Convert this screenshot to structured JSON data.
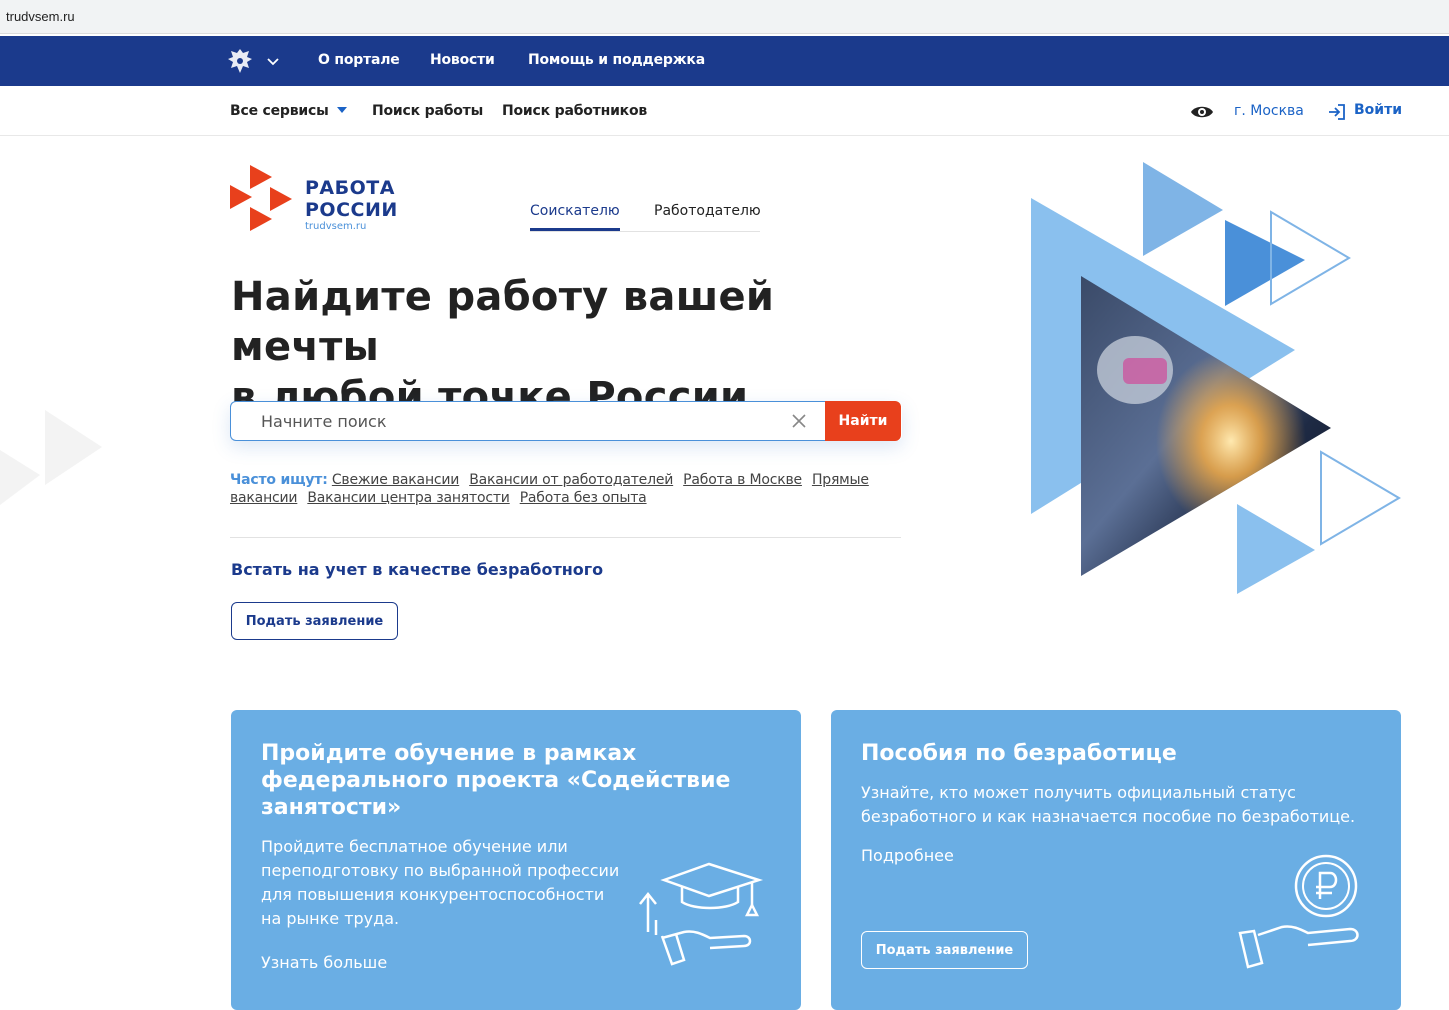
{
  "browser": {
    "url": "trudvsem.ru"
  },
  "gov_bar": {
    "emblem": "russian-coat-of-arms-icon",
    "links": [
      "О портале",
      "Новости",
      "Помощь и поддержка"
    ]
  },
  "nav": {
    "services": "Все сервисы",
    "job_search": "Поиск работы",
    "worker_search": "Поиск работников",
    "accessibility_icon": "eye-icon",
    "city": "г. Москва",
    "login": "Войти"
  },
  "logo": {
    "line1": "РАБОТА",
    "line2": "РОССИИ",
    "sub": "trudvsem.ru"
  },
  "tabs": [
    "Соискателю",
    "Работодателю"
  ],
  "hero": {
    "title_line1": "Найдите работу вашей мечты",
    "title_line2": "в любой точке России"
  },
  "search": {
    "placeholder": "Начните поиск",
    "button": "Найти"
  },
  "often": {
    "label": "Часто ищут:",
    "links": [
      "Свежие вакансии",
      "Вакансии от работодателей",
      "Работа в Москве",
      "Прямые вакансии",
      "Вакансии центра занятости",
      "Работа без опыта"
    ]
  },
  "unemployment": {
    "title": "Встать на учет в качестве безработного",
    "button": "Подать заявление"
  },
  "cards": {
    "training": {
      "title": "Пройдите обучение в рамках федерального проекта «Содействие занятости»",
      "desc": "Пройдите бесплатное обучение или переподготовку по выбранной профессии для повышения конкурентоспособности на рынке труда.",
      "more": "Узнать больше",
      "icon": "graduation-cap-hand-icon"
    },
    "benefits": {
      "title": "Пособия по безработице",
      "desc": "Узнайте, кто может получить официальный статус безработного и как назначается пособие по безработице.",
      "more": "Подробнее",
      "button": "Подать заявление",
      "icon": "ruble-coin-hand-icon"
    }
  },
  "colors": {
    "gov_blue": "#1b3a8c",
    "link_blue": "#1b63c6",
    "accent_red": "#e8401c",
    "card_blue": "#6aaee4"
  }
}
